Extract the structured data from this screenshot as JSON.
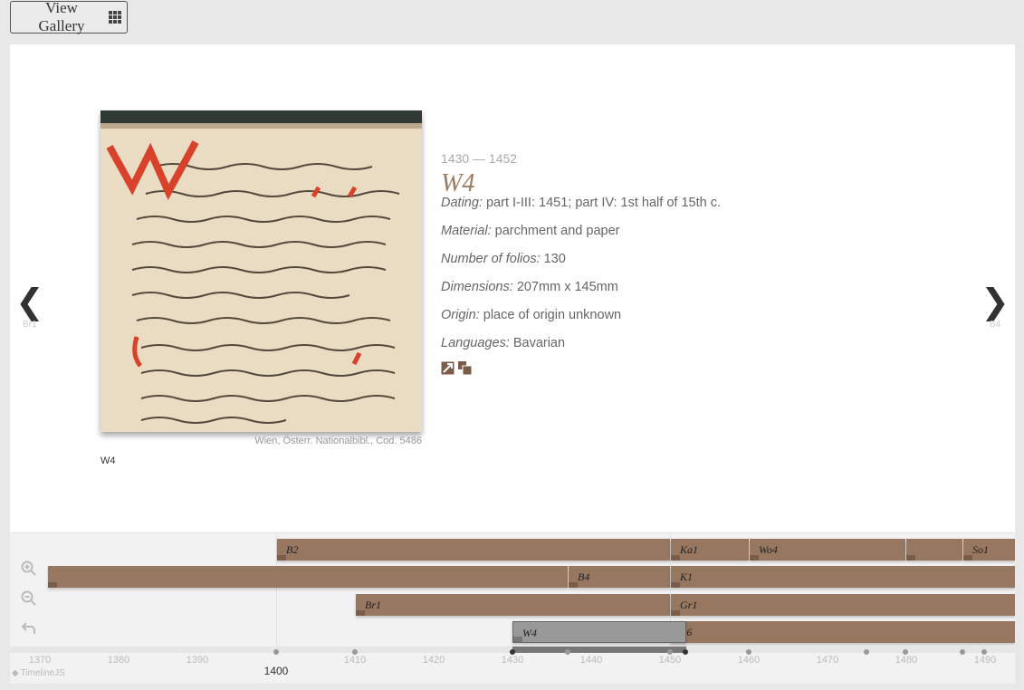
{
  "header": {
    "gallery_label": "View Gallery"
  },
  "navigation": {
    "prev_label": "Br1",
    "next_label": "B4",
    "prev_arrow": "❮",
    "next_arrow": "❯"
  },
  "slide": {
    "date": "1430 — 1452",
    "headline": "W4",
    "credit": "Wien, Österr. Nationalbibl., Cod. 5486",
    "caption": "W4",
    "fields": [
      {
        "label": "Dating:",
        "value": "part I-III: 1451; part IV: 1st half of 15th c."
      },
      {
        "label": "Material:",
        "value": "parchment and paper"
      },
      {
        "label": "Number of folios:",
        "value": "130"
      },
      {
        "label": "Dimensions:",
        "value": "207mm x 145mm"
      },
      {
        "label": "Origin:",
        "value": "place of origin unknown"
      },
      {
        "label": "Languages:",
        "value": "Bavarian"
      }
    ],
    "icons": [
      "expand-icon",
      "copy-icon"
    ]
  },
  "timeline": {
    "brand": "TimelineJS",
    "accent": "#987761",
    "ticks": [
      "1370",
      "1380",
      "1390",
      "1400",
      "1410",
      "1420",
      "1430",
      "1440",
      "1450",
      "1460",
      "1470",
      "1480",
      "1490"
    ],
    "major": "1400",
    "tools": [
      "zoom-in-icon",
      "zoom-out-icon",
      "back-icon"
    ],
    "events": [
      {
        "label": "B2"
      },
      {
        "label": "Ka1"
      },
      {
        "label": "Wo4"
      },
      {
        "label": "So1"
      },
      {
        "label": ""
      },
      {
        "label": "B4"
      },
      {
        "label": "K1"
      },
      {
        "label": "Br1"
      },
      {
        "label": "Gr1"
      },
      {
        "label": "W4"
      },
      {
        "label": "Β6"
      }
    ]
  },
  "colors": {
    "accent": "#987761",
    "headline": "#9c7b61"
  }
}
